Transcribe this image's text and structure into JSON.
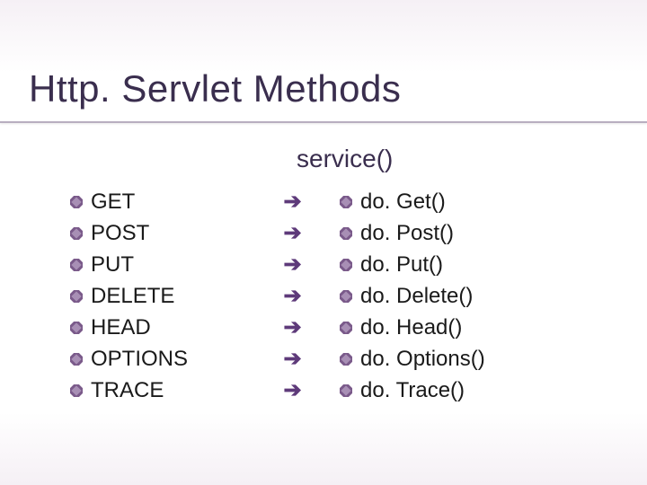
{
  "title": "Http. Servlet Methods",
  "subtitle": "service()",
  "rows": [
    {
      "method": "GET",
      "handler": "do. Get()"
    },
    {
      "method": "POST",
      "handler": "do. Post()"
    },
    {
      "method": "PUT",
      "handler": "do. Put()"
    },
    {
      "method": "DELETE",
      "handler": "do. Delete()"
    },
    {
      "method": "HEAD",
      "handler": "do. Head()"
    },
    {
      "method": "OPTIONS",
      "handler": "do. Options()"
    },
    {
      "method": "TRACE",
      "handler": "do. Trace()"
    }
  ],
  "arrow_glyph": "➔",
  "bullet_colors": {
    "outer": "#7a5a8a",
    "inner": "#a88fb5"
  }
}
